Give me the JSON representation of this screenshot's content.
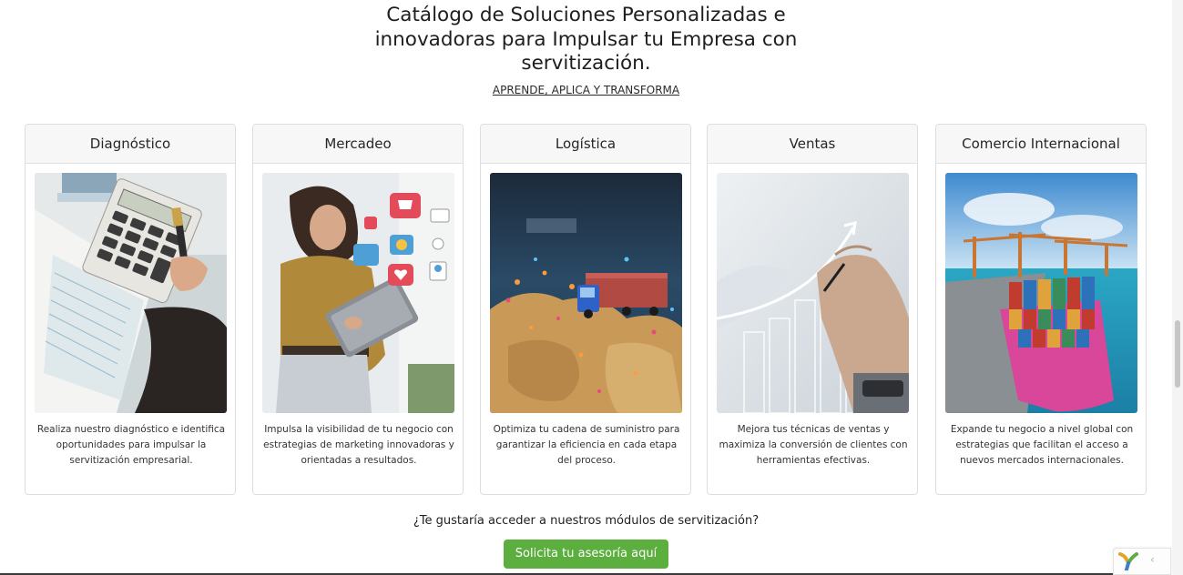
{
  "header": {
    "title_lines": [
      "Catálogo de Soluciones Personalizadas e",
      "innovadoras para Impulsar tu Empresa con",
      "servitización."
    ],
    "subtitle_link": "APRENDE, APLICA Y TRANSFORMA"
  },
  "cards": [
    {
      "title": "Diagnóstico",
      "image": "calculator-accounting-photo",
      "text": "Realiza nuestro diagnóstico e identifica oportunidades para impulsar la servitización empresarial."
    },
    {
      "title": "Mercadeo",
      "image": "woman-tablet-social-icons-photo",
      "text": "Impulsa la visibilidad de tu negocio con estrategias de marketing innovadoras y orientadas a resultados."
    },
    {
      "title": "Logística",
      "image": "trucks-on-map-photo",
      "text": "Optimiza tu cadena de suministro para garantizar la eficiencia en cada etapa del proceso."
    },
    {
      "title": "Ventas",
      "image": "hand-drawing-growth-chart-photo",
      "text": "Mejora tus técnicas de ventas y maximiza la conversión de clientes con herramientas efectivas."
    },
    {
      "title": "Comercio Internacional",
      "image": "container-ship-port-photo",
      "text": "Expande tu negocio a nivel global con estrategias que facilitan el acceso a nuevos mercados internacionales."
    }
  ],
  "footer": {
    "question": "¿Te gustaría acceder a nuestros módulos de servitización?",
    "cta_label": "Solicita tu asesoría aquí"
  },
  "widget": {
    "arrow": "‹"
  },
  "colors": {
    "cta_green": "#5cae3e",
    "card_border": "#dedede",
    "card_header_bg": "#f7f7f7"
  }
}
